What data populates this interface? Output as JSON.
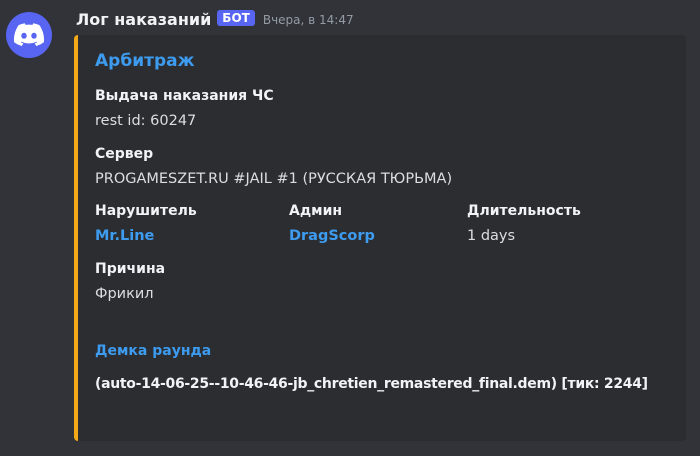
{
  "message": {
    "username": "Лог наказаний",
    "badge": "БОТ",
    "timestamp": "Вчера, в 14:47",
    "avatar_icon": "discord-logo-icon",
    "avatar_color": "#5865f2"
  },
  "embed": {
    "accent_color": "#f5a818",
    "title": "Арбитраж",
    "fields": {
      "punishment": {
        "name": "Выдача наказания ЧС",
        "value": "rest id: 60247"
      },
      "server": {
        "name": "Сервер",
        "value": "PROGAMESZET.RU #JAIL #1 (РУССКАЯ ТЮРЬМА)"
      },
      "violator": {
        "name": "Нарушитель",
        "value": "Mr.Line"
      },
      "admin": {
        "name": "Админ",
        "value": "DragScorp"
      },
      "duration": {
        "name": "Длительность",
        "value": "1 days"
      },
      "reason": {
        "name": "Причина",
        "value": "Фрикил"
      }
    },
    "demo": {
      "title": "Демка раунда",
      "file": "(auto-14-06-25--10-46-46-jb_chretien_remastered_final.dem) [тик: 2244]"
    }
  }
}
